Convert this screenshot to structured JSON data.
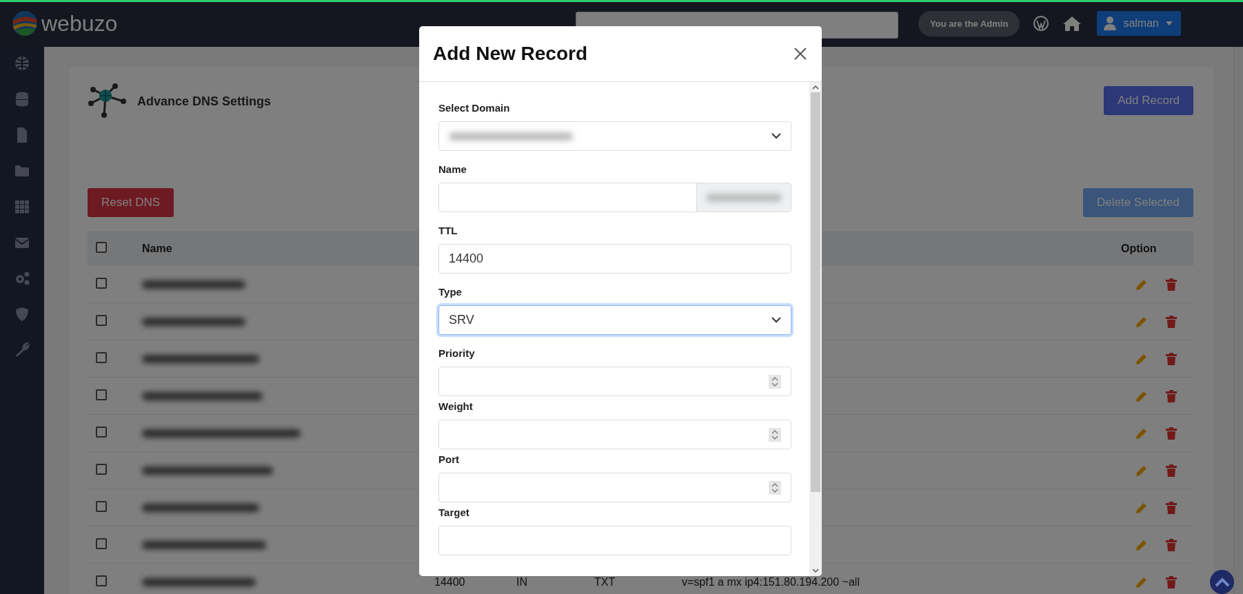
{
  "header": {
    "logo": "webuzo",
    "search": {
      "kind": "field"
    },
    "admin_badge": "You are the Admin",
    "user": "salman"
  },
  "page": {
    "title": "Advance DNS Settings",
    "add_button": "Add Record",
    "reset_button": "Reset DNS",
    "delete_button": {
      "label": "Delete Selected",
      "disabled": true
    }
  },
  "table": {
    "columns": [
      "Name",
      "Option"
    ],
    "select_all": {
      "checked": false
    },
    "rows": [
      {
        "checked": false
      },
      {
        "checked": false
      },
      {
        "checked": false
      },
      {
        "checked": false
      },
      {
        "checked": false
      },
      {
        "checked": false
      },
      {
        "checked": false
      },
      {
        "checked": false
      },
      {
        "checked": false,
        "ttl": "14400",
        "class": "IN",
        "type": "TXT",
        "record": "v=spf1 a mx ip4:151.80.194.200 ~all"
      }
    ]
  },
  "modal": {
    "title": "Add New Record",
    "fields": [
      {
        "label": "Select Domain",
        "kind": "select",
        "redacted": true,
        "focused": false
      },
      {
        "label": "Name",
        "kind": "addon-input",
        "redacted": true,
        "focused": false
      },
      {
        "label": "TTL",
        "kind": "text",
        "value": "14400",
        "focused": false
      },
      {
        "label": "Type",
        "kind": "select",
        "value": "SRV",
        "focused": true
      },
      {
        "label": "Priority",
        "kind": "number",
        "focused": false
      },
      {
        "label": "Weight",
        "kind": "number",
        "focused": false
      },
      {
        "label": "Port",
        "kind": "number",
        "focused": false
      },
      {
        "label": "Target",
        "kind": "text",
        "focused": false
      }
    ]
  }
}
